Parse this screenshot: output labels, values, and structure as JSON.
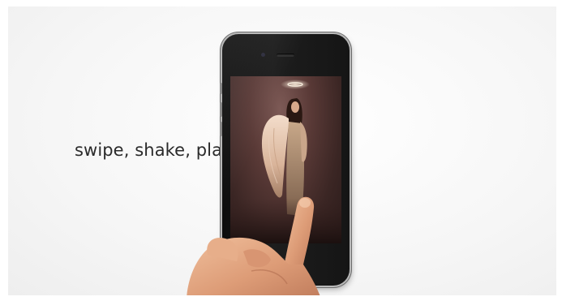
{
  "tagline": "swipe, shake, play",
  "colors": {
    "background": "#f4f4f4",
    "tagline_text": "#2a2a2a",
    "phone_body": "#151515",
    "screen_tone": "#4a302e",
    "skin": "#e3a47f"
  },
  "icons": {
    "phone": "smartphone-icon",
    "hand": "pointing-hand"
  }
}
